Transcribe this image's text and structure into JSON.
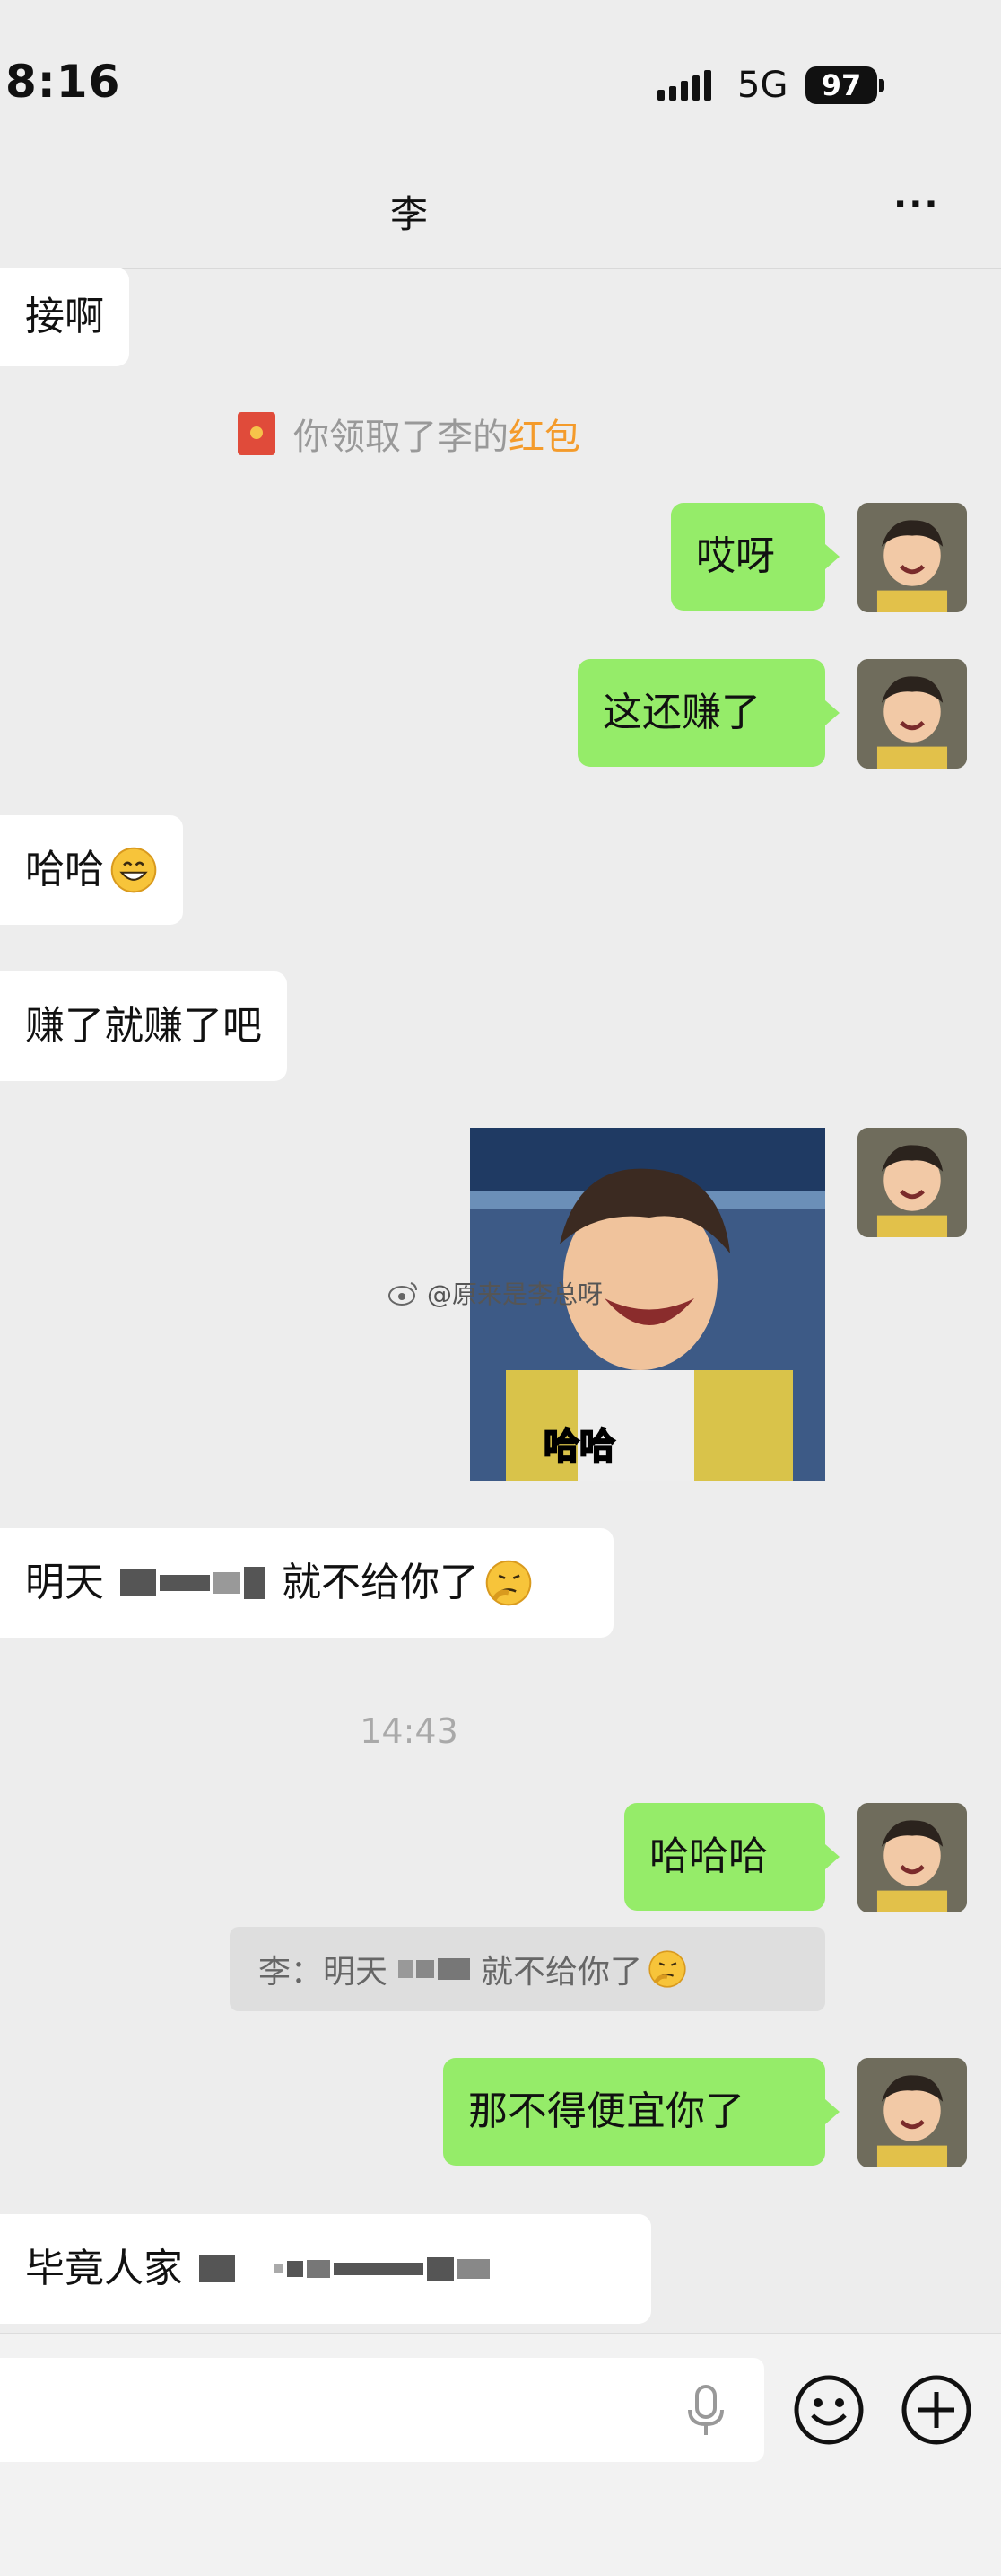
{
  "status": {
    "time": "8:16",
    "network": "5G",
    "battery": "97"
  },
  "header": {
    "title": "李",
    "more": "···"
  },
  "messages": {
    "m1": "接啊",
    "sys_prefix": "你领取了李的",
    "sys_link": "红包",
    "m2": "哎呀",
    "m3": "这还赚了",
    "m4": "哈哈",
    "m5": "赚了就赚了吧",
    "photo_caption": "哈哈",
    "watermark": "@原来是李总呀",
    "m6_pre": "明天",
    "m6_post": "就不给你了",
    "timestamp": "14:43",
    "m7": "哈哈哈",
    "quote_pre": "李：明天",
    "quote_post": "就不给你了",
    "m8": "那不得便宜你了",
    "m9": "毕竟人家"
  },
  "icons": {
    "mic": "microphone-icon",
    "emoji": "emoji-icon",
    "plus": "plus-icon",
    "red_packet": "red-packet-icon"
  },
  "colors": {
    "sent_bubble": "#95ec69",
    "received_bubble": "#ffffff",
    "background": "#ededed",
    "red_packet_link": "#f49b2b"
  }
}
